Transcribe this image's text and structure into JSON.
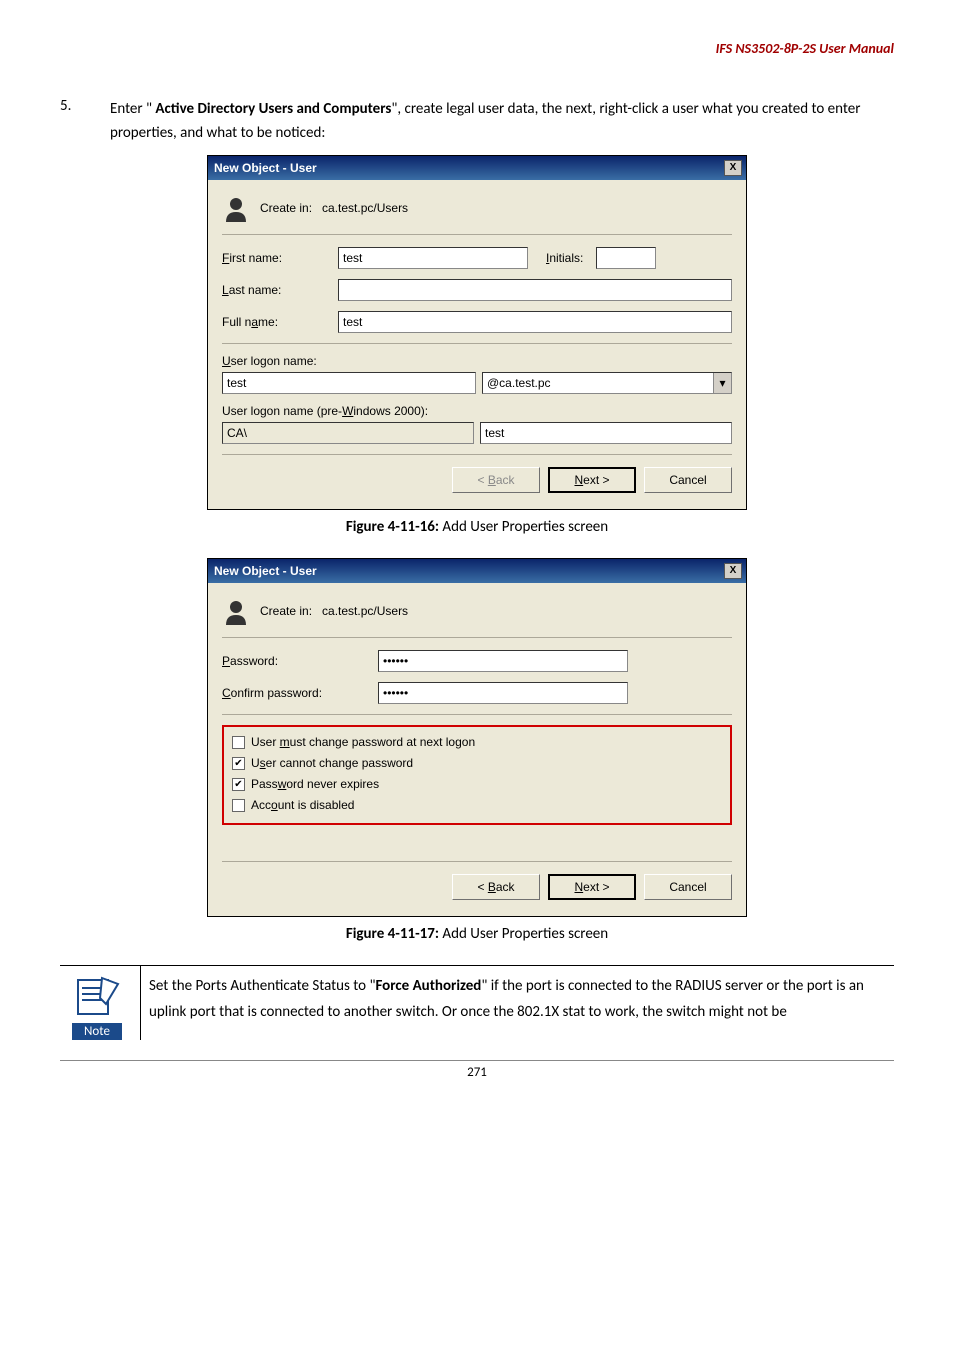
{
  "header": {
    "doc_title": "IFS  NS3502-8P-2S  User  Manual"
  },
  "step": {
    "num": "5.",
    "before": "Enter \" ",
    "bold": "Active Directory Users and Computers",
    "after": "\", create legal user data, the next, right-click a user what you created to enter properties, and what to be noticed:"
  },
  "dialog_common": {
    "title": "New Object - User",
    "close": "X",
    "create_in_label": "Create in:",
    "create_in_path": "ca.test.pc/Users"
  },
  "dialog1": {
    "first_name_label": "First name:",
    "first_name_value": "test",
    "initials_label": "Initials:",
    "initials_value": "",
    "last_name_label": "Last name:",
    "last_name_value": "",
    "full_name_label": "Full name:",
    "full_name_value": "test",
    "user_logon_label": "User logon name:",
    "user_logon_value": "test",
    "domain_value": "@ca.test.pc",
    "pre2000_label": "User logon name (pre-Windows 2000):",
    "pre2000_domain": "CA\\",
    "pre2000_value": "test",
    "back": "< Back",
    "next": "Next >",
    "cancel": "Cancel"
  },
  "caption1": {
    "bold": "Figure 4-11-16:",
    "rest": " Add User Properties screen"
  },
  "dialog2": {
    "password_label": "Password:",
    "password_value": "••••••",
    "confirm_label": "Confirm password:",
    "confirm_value": "••••••",
    "chk_must_change": "User must change password at next logon",
    "chk_cannot_change": "User cannot change password",
    "chk_never_expires": "Password never expires",
    "chk_disabled": "Account is disabled",
    "chk_must_change_checked": false,
    "chk_cannot_change_checked": true,
    "chk_never_expires_checked": true,
    "chk_disabled_checked": false,
    "back": "< Back",
    "next": "Next >",
    "cancel": "Cancel"
  },
  "caption2": {
    "bold": "Figure 4-11-17:",
    "rest": " Add User Properties screen"
  },
  "note": {
    "label": "Note",
    "before": "Set the Ports Authenticate Status to \"",
    "bold": "Force Authorized",
    "after": "\" if the port is connected to the RADIUS server or the port is an uplink port that is connected to another switch. Or once the 802.1X stat to work, the switch might not be"
  },
  "page_number": "271",
  "chart_data": null
}
